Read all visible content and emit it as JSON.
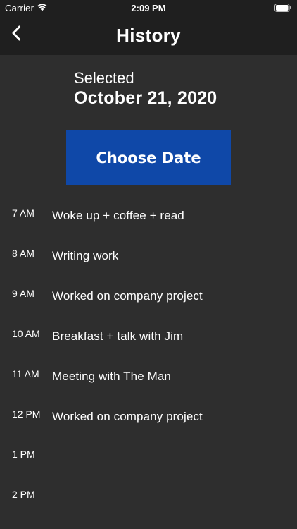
{
  "status_bar": {
    "carrier": "Carrier",
    "time": "2:09 PM",
    "wifi_icon": "wifi-icon",
    "battery_icon": "battery-icon"
  },
  "nav": {
    "back_icon": "chevron-left-icon",
    "title": "History"
  },
  "selection": {
    "label": "Selected",
    "date": "October 21, 2020"
  },
  "choose_date_button": {
    "label": "Choose Date",
    "color": "#0f48a8"
  },
  "timeline": [
    {
      "time": "7 AM",
      "text": "Woke up + coffee + read"
    },
    {
      "time": "8 AM",
      "text": "Writing work"
    },
    {
      "time": "9 AM",
      "text": "Worked on company project"
    },
    {
      "time": "10 AM",
      "text": "Breakfast + talk with Jim"
    },
    {
      "time": "11 AM",
      "text": "Meeting with The Man"
    },
    {
      "time": "12 PM",
      "text": "Worked on company project"
    },
    {
      "time": "1 PM",
      "text": ""
    },
    {
      "time": "2 PM",
      "text": ""
    }
  ],
  "colors": {
    "background": "#2e2e2e",
    "header": "#1f1f1f",
    "text": "#ffffff"
  }
}
